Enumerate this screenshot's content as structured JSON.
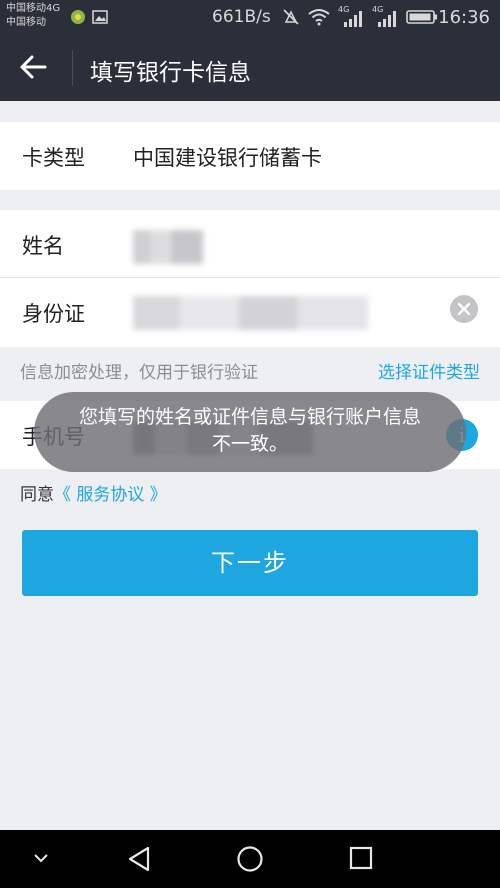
{
  "status_bar": {
    "carrier_line1": "中国移动4G",
    "carrier_line2": "中国移动",
    "net_speed": "661B/s",
    "time": "16:36",
    "network_badge_1": "4G",
    "network_badge_2": "4G",
    "icons": [
      "app-notification-icon",
      "image-icon",
      "mute-icon",
      "wifi-icon",
      "signal-icon",
      "signal-icon",
      "battery-icon"
    ]
  },
  "header": {
    "title": "填写银行卡信息",
    "back_icon": "back-arrow-icon"
  },
  "form": {
    "card_type": {
      "label": "卡类型",
      "value": "中国建设银行储蓄卡"
    },
    "name": {
      "label": "姓名"
    },
    "id_card": {
      "label": "身份证"
    },
    "hint_left": "信息加密处理，仅用于银行验证",
    "hint_right": "选择证件类型",
    "phone": {
      "label": "手机号"
    }
  },
  "agreement": {
    "prefix": "同意",
    "link": "《 服务协议 》"
  },
  "next_button": "下一步",
  "toast": {
    "line1": "您填写的姓名或证件信息与银行账户信息",
    "line2": "不一致。"
  },
  "colors": {
    "header_bg": "#2b2f3a",
    "accent": "#1ea6e0",
    "page_bg": "#eeeff3"
  }
}
